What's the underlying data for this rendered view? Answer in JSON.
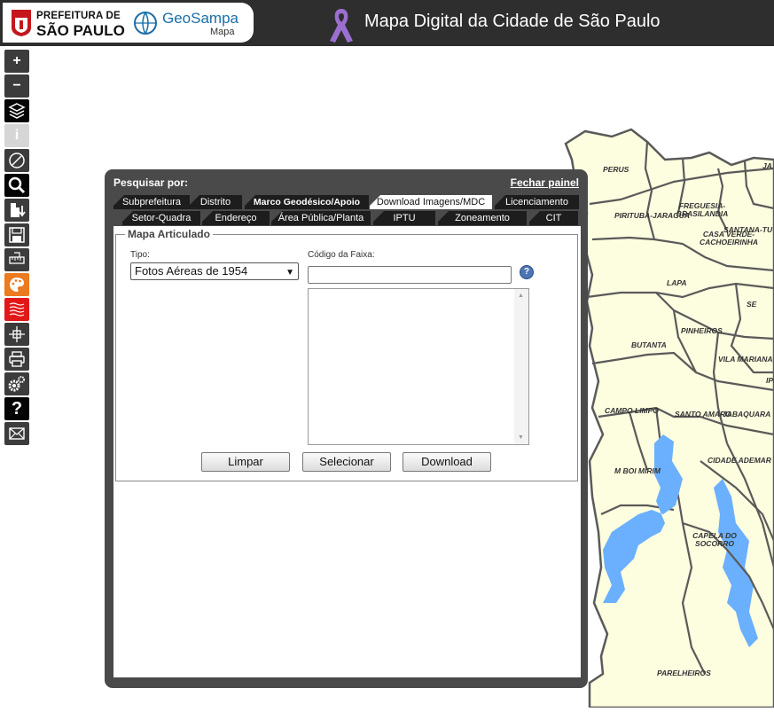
{
  "header": {
    "prefeitura_line1": "PREFEITURA DE",
    "prefeitura_line2": "SÃO PAULO",
    "geosampa_title": "GeoSampa",
    "geosampa_subtitle": "Mapa",
    "app_title": "Mapa Digital da Cidade de São Paulo",
    "ribbon_color": "#9b6fd0"
  },
  "toolbar": {
    "zoom_in": "+",
    "zoom_out": "−",
    "info": "i",
    "help": "?"
  },
  "panel": {
    "header_label": "Pesquisar por:",
    "close_label": "Fechar painel",
    "tabs_row1": [
      "Subprefeitura",
      "Distrito",
      "Marco Geodésico/Apoio",
      "Download Imagens/MDC",
      "Licenciamento"
    ],
    "tabs_row2": [
      "Setor-Quadra",
      "Endereço",
      "Área Pública/Planta",
      "IPTU",
      "Zoneamento",
      "CIT"
    ],
    "active_tab": "Download Imagens/MDC",
    "fieldset_legend": "Mapa Articulado",
    "tipo_label": "Tipo:",
    "tipo_value": "Fotos Aéreas de 1954",
    "codigo_label": "Código da Faixa:",
    "codigo_value": "",
    "help_icon": "?",
    "buttons": {
      "limpar": "Limpar",
      "selecionar": "Selecionar",
      "download": "Download"
    }
  },
  "map": {
    "land_color": "#fdfde0",
    "water_color": "#6ab0ff",
    "border_color": "#5a5a5a",
    "labels": [
      "PERUS",
      "JA",
      "PIRITUBA-JARAGUA",
      "FREGUESIA-BRASILANDIA",
      "SANTANA-TU",
      "CASA VERDE-CACHOEIRINHA",
      "LAPA",
      "SE",
      "PINHEIROS",
      "BUTANTA",
      "VILA MARIANA",
      "IPI",
      "CAMPO LIMPO",
      "SANTO AMARO",
      "JABAQUARA",
      "M BOI MIRIM",
      "CIDADE ADEMAR",
      "CAPELA DO SOCORRO",
      "PARELHEIROS"
    ]
  }
}
